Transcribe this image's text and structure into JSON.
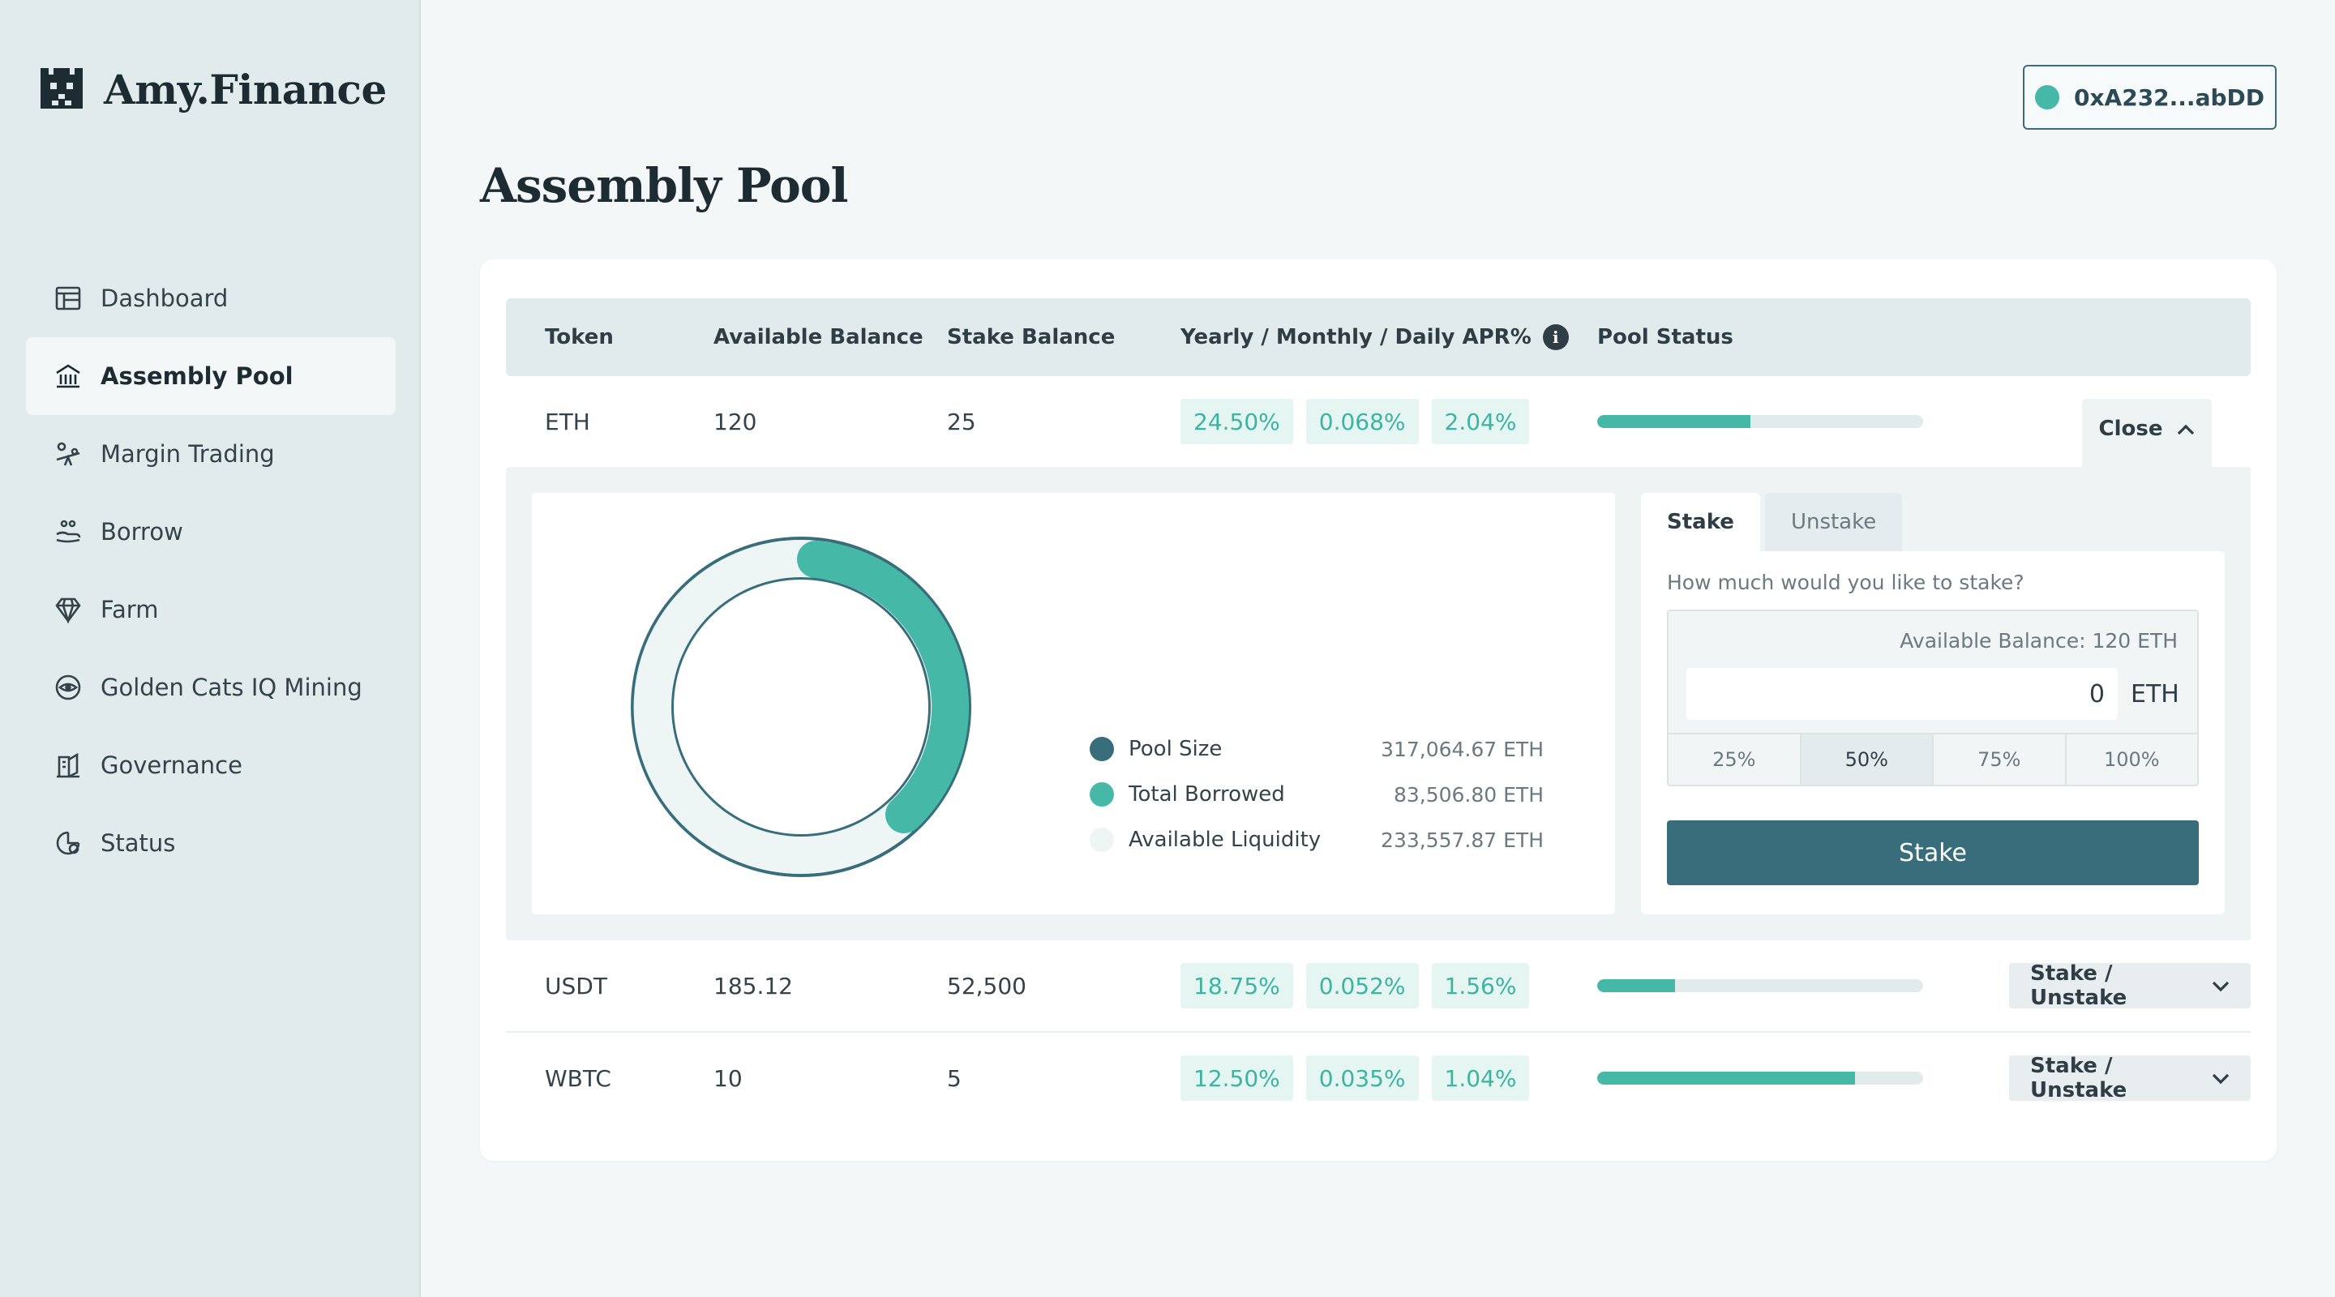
{
  "app": {
    "logo_text": "Amy.Finance",
    "wallet_address": "0xA232...abDD",
    "page_title": "Assembly Pool"
  },
  "sidebar": {
    "items": [
      {
        "label": "Dashboard",
        "icon": "dashboard-icon"
      },
      {
        "label": "Assembly Pool",
        "icon": "bank-icon"
      },
      {
        "label": "Margin Trading",
        "icon": "seesaw-icon"
      },
      {
        "label": "Borrow",
        "icon": "hand-coin-icon"
      },
      {
        "label": "Farm",
        "icon": "diamond-icon"
      },
      {
        "label": "Golden Cats IQ Mining",
        "icon": "eye-coin-icon"
      },
      {
        "label": "Governance",
        "icon": "ballot-icon"
      },
      {
        "label": "Status",
        "icon": "pie-status-icon"
      }
    ],
    "active": "Assembly Pool"
  },
  "table": {
    "headers": {
      "token": "Token",
      "available_balance": "Available Balance",
      "stake_balance": "Stake Balance",
      "apr": "Yearly / Monthly / Daily APR%",
      "pool_status": "Pool Status"
    },
    "rows": [
      {
        "token": "ETH",
        "available": "120",
        "stake": "25",
        "yearly": "24.50%",
        "monthly": "0.068%",
        "daily": "2.04%",
        "pool_status_fraction": 0.47,
        "action": "Close"
      },
      {
        "token": "USDT",
        "available": "185.12",
        "stake": "52,500",
        "yearly": "18.75%",
        "monthly": "0.052%",
        "daily": "1.56%",
        "pool_status_fraction": 0.24,
        "action": "Stake / Unstake"
      },
      {
        "token": "WBTC",
        "available": "10",
        "stake": "5",
        "yearly": "12.50%",
        "monthly": "0.035%",
        "daily": "1.04%",
        "pool_status_fraction": 0.79,
        "action": "Stake / Unstake"
      }
    ]
  },
  "pool_detail": {
    "legend": [
      {
        "label": "Pool Size",
        "value": "317,064.67 ETH",
        "color": "#386d7b"
      },
      {
        "label": "Total Borrowed",
        "value": "83,506.80 ETH",
        "color": "#45b8a8"
      },
      {
        "label": "Available Liquidity",
        "value": "233,557.87 ETH",
        "color": "#eef6f5"
      }
    ],
    "tabs": [
      "Stake",
      "Unstake"
    ],
    "active_tab": "Stake",
    "question": "How much would you like to stake?",
    "available_balance": "Available Balance: 120 ETH",
    "amount": "0",
    "unit": "ETH",
    "percent_options": [
      "25%",
      "50%",
      "75%",
      "100%"
    ],
    "active_percent": "50%",
    "submit_label": "Stake"
  },
  "colors": {
    "accent": "#45b8a8",
    "primary": "#386d7b",
    "sidebar_bg": "#e2ebec"
  }
}
